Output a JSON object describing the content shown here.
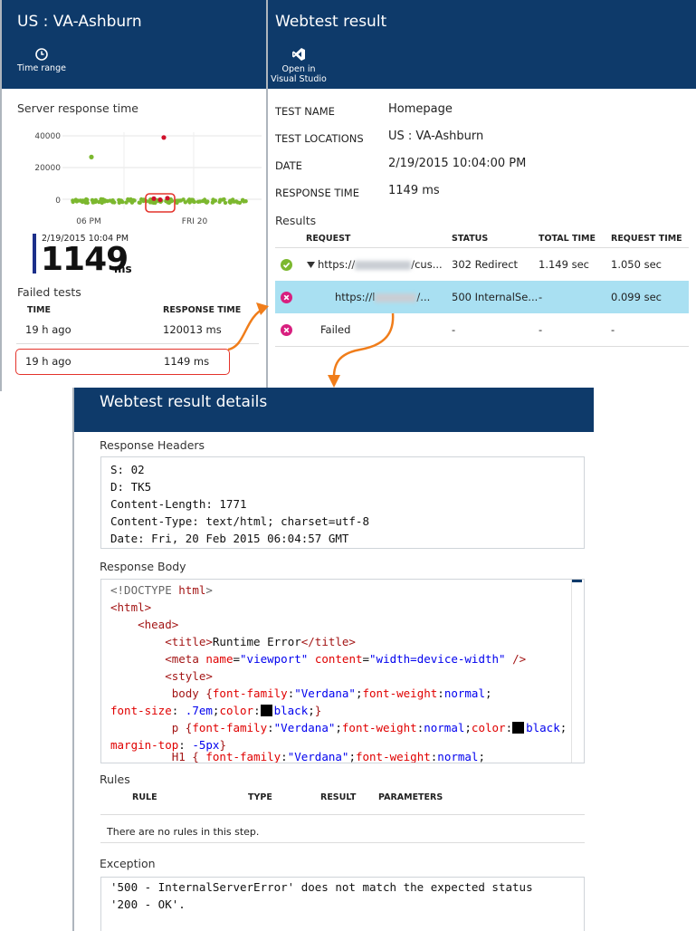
{
  "left_blade": {
    "title": "US : VA-Ashburn",
    "time_range_label": "Time range",
    "chart_title": "Server response time",
    "chart_data": {
      "type": "scatter",
      "title": "Server response time",
      "y_ticks": [
        "40000",
        "20000",
        "0"
      ],
      "x_ticks": [
        "06 PM",
        "FRI 20"
      ],
      "ylim": [
        0,
        45000
      ],
      "series": [
        {
          "values": [
            27000
          ],
          "color": "#7cb82f"
        },
        {
          "values": [
            39000
          ],
          "color": "#d0102b"
        }
      ]
    },
    "selected_date": "2/19/2015 10:04 PM",
    "selected_value": "1149",
    "selected_unit": "ms",
    "failed_title": "Failed tests",
    "col_time": "TIME",
    "col_response": "RESPONSE TIME",
    "rows": [
      {
        "time": "19 h ago",
        "response": "120013 ms"
      },
      {
        "time": "19 h ago",
        "response": "1149 ms"
      }
    ]
  },
  "right_blade": {
    "title": "Webtest result",
    "open_vs_line1": "Open in",
    "open_vs_line2": "Visual Studio",
    "props": {
      "test_name_label": "TEST NAME",
      "test_name": "Homepage",
      "locations_label": "TEST LOCATIONS",
      "locations": "US : VA-Ashburn",
      "date_label": "DATE",
      "date": "2/19/2015 10:04:00 PM",
      "response_label": "RESPONSE TIME",
      "response": "1149 ms"
    },
    "results_title": "Results",
    "headers": {
      "request": "REQUEST",
      "status": "STATUS",
      "total": "TOTAL TIME",
      "request_time": "REQUEST TIME"
    },
    "rows": [
      {
        "url_prefix": "https://",
        "url_suffix": "/cus...",
        "status": "302 Redirect",
        "total": "1.149 sec",
        "req": "1.050 sec"
      },
      {
        "url_prefix": "https://l",
        "url_suffix": "/...",
        "status": "500 InternalSe...",
        "total": "-",
        "req": "0.099 sec"
      },
      {
        "url_prefix": "Failed",
        "status": "-",
        "total": "-",
        "req": "-"
      }
    ]
  },
  "details": {
    "title": "Webtest result details",
    "response_headers_label": "Response Headers",
    "headers_lines": [
      "S: 02",
      "D: TK5",
      "Content-Length: 1771",
      "Content-Type: text/html; charset=utf-8",
      "Date: Fri, 20 Feb 2015 06:04:57 GMT"
    ],
    "response_body_label": "Response Body",
    "body": {
      "doctype": "<!DOCTYPE ",
      "doctype_word": "html",
      "doctype_end": ">",
      "html_open": "<html>",
      "head_open": "<head>",
      "title_open": "<title>",
      "title_text": "Runtime Error",
      "title_close": "</title>",
      "meta_open": "<meta ",
      "meta_name_attr": "name",
      "meta_name_val": "\"viewport\"",
      "meta_content_attr": "content",
      "meta_content_val": "\"width=device-width\"",
      "meta_close": " />",
      "style_open": "<style>",
      "body_sel": "body {",
      "ff": "font-family",
      "ff_val": "\"Verdana\"",
      "fw": "font-weight",
      "fw_val": "normal",
      "fs": "font-size",
      "fs_val": " .7em",
      "color": "color",
      "black": "black",
      "close_brace": "}",
      "p_sel": "p {",
      "mt": "margin-top",
      "mt_val": " -5px",
      "h1_sel": "H1 { "
    },
    "rules_label": "Rules",
    "rules_headers": {
      "rule": "RULE",
      "type": "TYPE",
      "result": "RESULT",
      "params": "PARAMETERS"
    },
    "rules_empty": "There are no rules in this step.",
    "exception_label": "Exception",
    "exception_line1": "'500 - InternalServerError' does not match the expected status",
    "exception_line2": "'200 - OK'.",
    "colors": {
      "header": "#0e3a6a",
      "selected_row": "#a9e0f2",
      "callout": "#e4332b",
      "arrow": "#f07d1a"
    }
  }
}
